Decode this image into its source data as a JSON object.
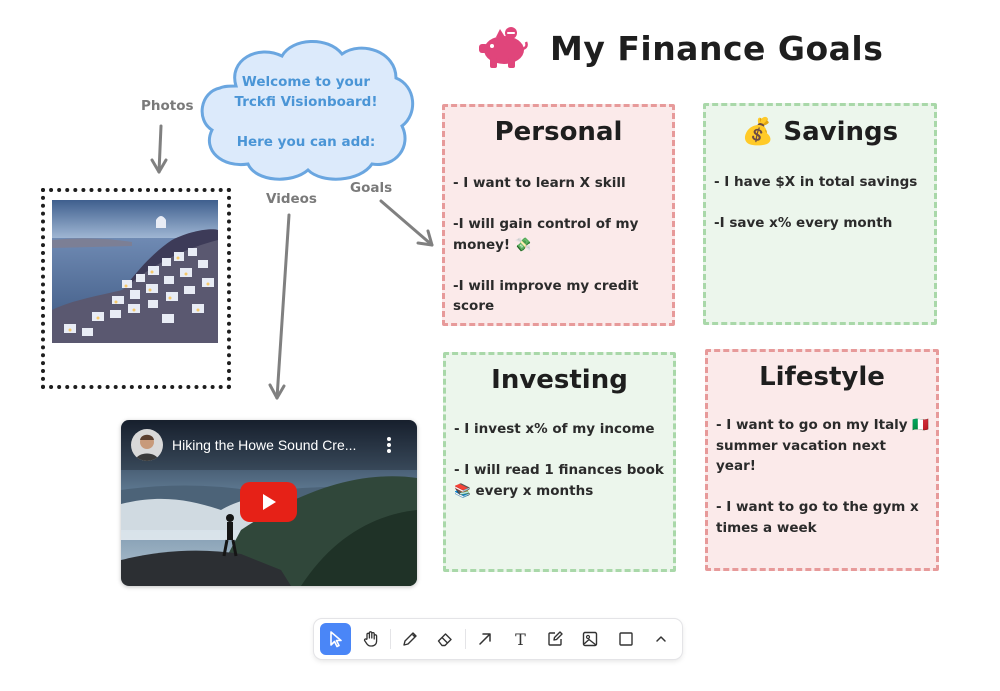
{
  "title": {
    "text": "My Finance Goals",
    "icon": "piggy-bank-icon",
    "icon_color": "#e0457b"
  },
  "cloud": {
    "line1": "Welcome to your",
    "line2": "Trckfi Visionboard!",
    "line3": "Here you can add:",
    "fill": "#dceafb",
    "stroke": "#6aa6e0",
    "text_color": "#4a95d6"
  },
  "labels": {
    "photos": "Photos",
    "videos": "Videos",
    "goals": "Goals"
  },
  "video": {
    "title": "Hiking the Howe Sound Cre..."
  },
  "cards": {
    "personal": {
      "title": "Personal",
      "items": [
        "- I want to learn X skill",
        "-I will gain control of my money! 💸",
        "-I will improve my credit score"
      ]
    },
    "savings": {
      "title": "💰 Savings",
      "items": [
        "- I have $X in total savings",
        "-I save x% every month"
      ]
    },
    "investing": {
      "title": "Investing",
      "items": [
        "- I invest x% of my income",
        "- I will read 1 finances book 📚 every x months"
      ]
    },
    "lifestyle": {
      "title": "Lifestyle",
      "items": [
        "- I want to go on my Italy 🇮🇹 summer vacation next year!",
        "- I want to go to the gym x times a week"
      ]
    }
  },
  "colors": {
    "pink_card": "#fbeaea",
    "pink_border": "#e79a9a",
    "green_card": "#ecf6ec",
    "green_border": "#a9d8a9",
    "accent": "#4a86f7"
  },
  "toolbar": {
    "tools": [
      "select-icon",
      "hand-icon",
      "pencil-icon",
      "eraser-icon",
      "arrow-icon",
      "text-icon",
      "note-icon",
      "image-icon",
      "rectangle-icon",
      "chevron-up-icon"
    ],
    "active": "select-icon",
    "text_tool_label": "T"
  }
}
